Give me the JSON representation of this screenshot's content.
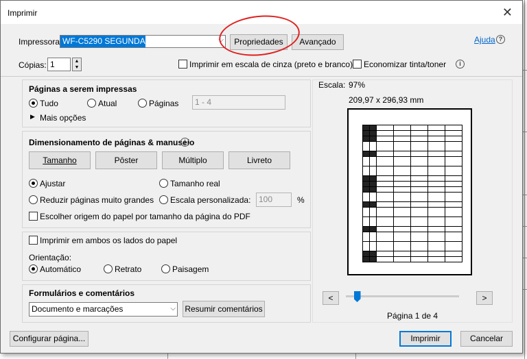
{
  "dialog": {
    "title": "Imprimir"
  },
  "printer": {
    "label": "Impressora:",
    "selected": "WF-C5290 SEGUNDA",
    "properties_label": "Propriedades",
    "advanced_label": "Avançado",
    "help_label": "Ajuda"
  },
  "copies": {
    "label": "Cópias:",
    "value": "1"
  },
  "options": {
    "grayscale_label": "Imprimir em escala de cinza (preto e branco)",
    "save_ink_label": "Economizar tinta/toner"
  },
  "pages": {
    "heading": "Páginas a serem impressas",
    "all_label": "Tudo",
    "current_label": "Atual",
    "pages_label": "Páginas",
    "range_placeholder": "1 - 4",
    "more_options_label": "Mais opções"
  },
  "sizing": {
    "heading": "Dimensionamento de páginas & manuseio",
    "tabs": [
      "Tamanho",
      "Pôster",
      "Múltiplo",
      "Livreto"
    ],
    "fit_label": "Ajustar",
    "actual_size_label": "Tamanho real",
    "shrink_label": "Reduzir páginas muito grandes",
    "custom_scale_label": "Escala personalizada:",
    "custom_scale_value": "100",
    "percent": "%",
    "paper_source_label": "Escolher origem do papel por tamanho da página do PDF"
  },
  "duplex": {
    "both_sides_label": "Imprimir em ambos os lados do papel",
    "orientation_label": "Orientação:",
    "auto_label": "Automático",
    "portrait_label": "Retrato",
    "landscape_label": "Paisagem"
  },
  "comments": {
    "heading": "Formulários e comentários",
    "selected": "Documento e marcações",
    "summarize_label": "Resumir comentários"
  },
  "preview": {
    "scale_label": "Escala:",
    "scale_value": "97%",
    "dimensions": "209,97 x 296,93 mm",
    "prev_label": "<",
    "next_label": ">",
    "page_status": "Página 1 de 4",
    "slider_position": 0.1
  },
  "footer": {
    "page_setup_label": "Configurar página...",
    "print_label": "Imprimir",
    "cancel_label": "Cancelar"
  },
  "colors": {
    "accent": "#0078d7",
    "annotation_red": "#e02020"
  }
}
